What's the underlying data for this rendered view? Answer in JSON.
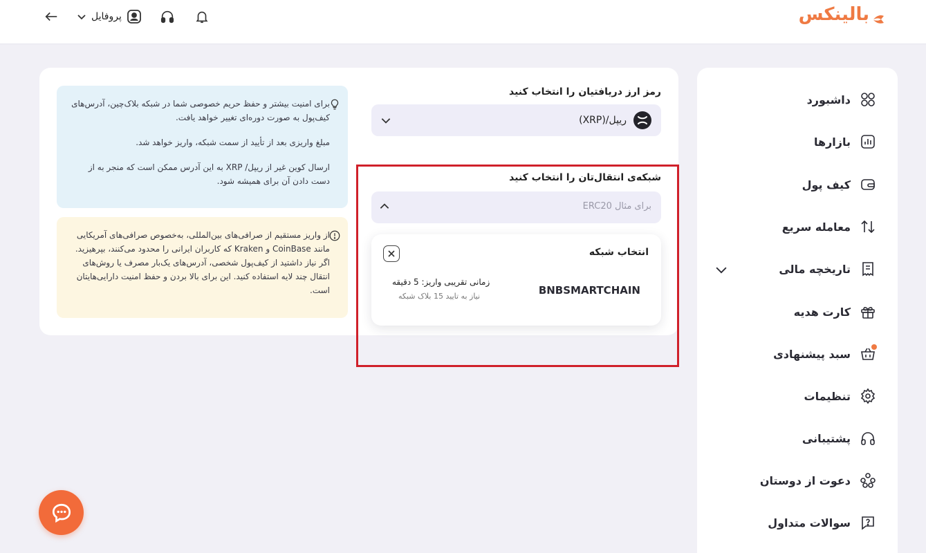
{
  "brand": {
    "name": "بالینکس",
    "color": "#ef7a43"
  },
  "header": {
    "profile_label": "پروفایل",
    "icons": [
      "back-arrow-icon",
      "chevron-down-icon",
      "user-icon",
      "headset-icon",
      "bell-icon"
    ]
  },
  "sidebar": {
    "items": [
      {
        "label": "داشبورد",
        "icon": "grid-icon"
      },
      {
        "label": "بازارها",
        "icon": "chart-bars-icon"
      },
      {
        "label": "کیف پول",
        "icon": "wallet-icon"
      },
      {
        "label": "معامله سریع",
        "icon": "swap-arrows-icon"
      },
      {
        "label": "تاریخچه مالی",
        "icon": "receipt-icon",
        "expandable": true
      },
      {
        "label": "کارت هدیه",
        "icon": "gift-icon"
      },
      {
        "label": "سبد پیشنهادی",
        "icon": "basket-icon",
        "has_badge": true
      },
      {
        "label": "تنظیمات",
        "icon": "gear-icon"
      },
      {
        "label": "پشتیبانی",
        "icon": "headset-icon"
      },
      {
        "label": "دعوت از دوستان",
        "icon": "people-icon"
      },
      {
        "label": "سوالات متداول",
        "icon": "question-chat-icon"
      }
    ]
  },
  "deposit": {
    "coin_field_title": "رمز ارز دریافتیان را انتخاب کنید",
    "coin_selected": "ریپل/(XRP)",
    "network_field_title": "شبکه‌ی انتقال‌تان را انتخاب کنید",
    "network_placeholder": "برای مثال ERC20",
    "network_panel": {
      "title": "انتخاب شبکه",
      "option": {
        "name": "BNBSMARTCHAIN",
        "eta": "زمانی تقریبی واریز: 5 دقیقه",
        "confirmations": "نیاز به تایید 15 بلاک شبکه"
      }
    }
  },
  "info_blue": {
    "paragraphs": [
      "برای امنیت بیشتر و حفظ حریم خصوصی شما در شبکه بلاک‌چین، آدرس‌های کیف‌پول به صورت دوره‌ای تغییر خواهد یافت.",
      "مبلغ واریزی بعد از تأیید از سمت شبکه، واریز خواهد شد.",
      "ارسال کوین غیر از ریپل/ XRP به این آدرس ممکن است که منجر به از دست دادن آن برای همیشه شود."
    ]
  },
  "info_yellow": {
    "text": "از واریز مستقیم از صرافی‌های بین‌المللی، به‌خصوص صرافی‌های آمریکایی مانند CoinBase و Kraken که کاربران ایرانی را محدود می‌کنند، بپرهیزید. اگر نیاز داشتید از کیف‌پول شخصی، آدرس‌های یک‌بار مصرف یا روش‌های انتقال چند لایه استفاده کنید. این برای بالا بردن و حفظ امنیت دارایی‌هایتان است."
  },
  "colors": {
    "accent": "#ef7a43",
    "info_blue_bg": "#e4f2f9",
    "info_yellow_bg": "#fdf6e1",
    "field_bg": "#eeedf8",
    "highlight": "#d0202a"
  }
}
